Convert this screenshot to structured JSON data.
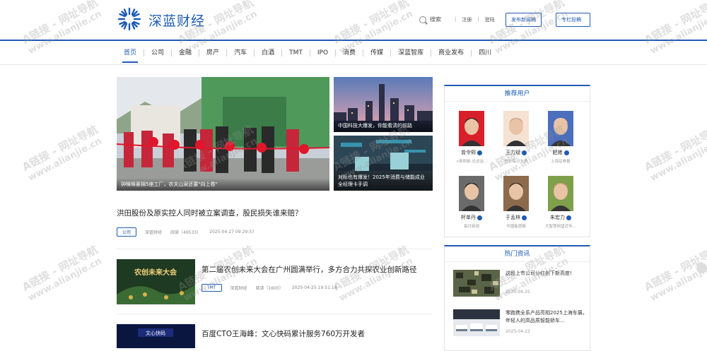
{
  "brand": {
    "name": "深蓝财经"
  },
  "header": {
    "search_label": "搜索",
    "login_label": "注册",
    "register_label": "登陆",
    "publish_button": "发布新闻稿",
    "contribute_button": "专栏投稿"
  },
  "nav": {
    "items": [
      "首页",
      "公司",
      "金融",
      "房产",
      "汽车",
      "白酒",
      "TMT",
      "IPO",
      "消费",
      "传媒",
      "深蓝智库",
      "商业发布",
      "四川"
    ]
  },
  "hero": {
    "main_caption": "钟眯眯豪捐5座工厂，农夫山泉还要\"向上卷\"",
    "side1_caption": "中国科技大爆发，你能看清的前路",
    "side2_caption": "对标也有爆发！2025年消费与储能成业全经理卡手调"
  },
  "articles": [
    {
      "title": "洪田股份及原实控人同时被立案调查，股民损失谁来赔？",
      "tag": "公司",
      "source": "深蓝财经",
      "reads": "阅读（49533）",
      "date": "2025-04-27 09:29:57"
    },
    {
      "title": "第二届农创未来大会在广州圆满举行，多方合力共探农业创新路径",
      "tag": "TMT",
      "source": "深蓝财经",
      "reads": "阅读（1600）",
      "date": "2025-04-25 19:51:18"
    },
    {
      "title": "百度CTO王海峰：文心快码累计服务760万开发者"
    }
  ],
  "thumbs": {
    "article2": "农创未来大会",
    "article3": "文心快码"
  },
  "recommended_users": {
    "title": "推荐用户",
    "users": [
      {
        "name": "曾令熙",
        "org": "<新财前·论达话..."
      },
      {
        "name": "王力斌",
        "org": "快乐每日头条"
      },
      {
        "name": "肥猪",
        "org": "上海证券报"
      },
      {
        "name": "杯单丹",
        "org": "每日新闻"
      },
      {
        "name": "于孟林",
        "org": "中国能源报"
      },
      {
        "name": "朱宏力",
        "org": "大智慧网望近年..."
      }
    ]
  },
  "hot_news": {
    "title": "热门资讯",
    "items": [
      {
        "title": "这段上市公司分红创下新高度!",
        "date": "2025-04-25"
      },
      {
        "title": "零跑携全系产品亮相2025上海车展，年轻人的高品质智能轿车...",
        "date": "2025-04-23"
      }
    ]
  },
  "watermark": {
    "line1": "A链接 - 网址导航",
    "line2": "www.alianjie.cn"
  },
  "colors": {
    "accent": "#1e5bb5"
  }
}
